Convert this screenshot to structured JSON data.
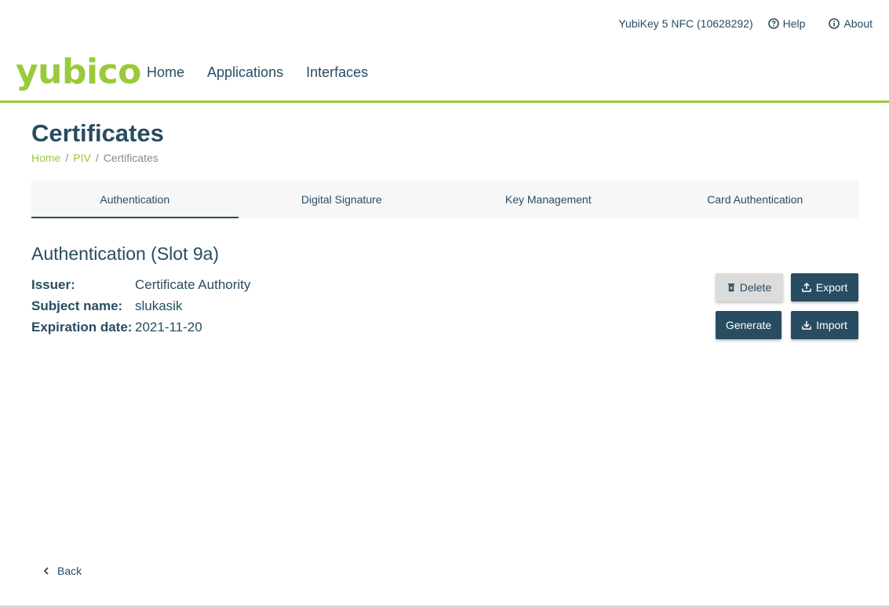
{
  "topbar": {
    "device": "YubiKey 5 NFC (10628292)",
    "help_label": "Help",
    "about_label": "About"
  },
  "header": {
    "logo_text": "yubico",
    "nav": [
      "Home",
      "Applications",
      "Interfaces"
    ]
  },
  "page": {
    "title": "Certificates",
    "breadcrumb": [
      "Home",
      "PIV",
      "Certificates"
    ]
  },
  "tabs": [
    {
      "label": "Authentication",
      "active": true
    },
    {
      "label": "Digital Signature",
      "active": false
    },
    {
      "label": "Key Management",
      "active": false
    },
    {
      "label": "Card Authentication",
      "active": false
    }
  ],
  "slot": {
    "title": "Authentication (Slot 9a)",
    "details": [
      {
        "label": "Issuer:",
        "value": "Certificate Authority"
      },
      {
        "label": "Subject name:",
        "value": "slukasik"
      },
      {
        "label": "Expiration date:",
        "value": "2021-11-20"
      }
    ]
  },
  "actions": {
    "delete_label": "Delete",
    "export_label": "Export",
    "generate_label": "Generate",
    "import_label": "Import"
  },
  "footer": {
    "back_label": "Back"
  },
  "colors": {
    "brand_green": "#9aca3c",
    "primary_dark": "#284c61",
    "tab_bg": "#f7f7f7",
    "button_light": "#dcdcdc"
  }
}
